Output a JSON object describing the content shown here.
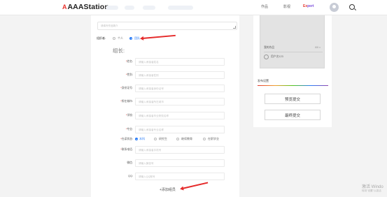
{
  "header": {
    "logo_mark": "A",
    "logo_text": "AAAStation",
    "nav_right": [
      "作品",
      "影视",
      "Expert"
    ],
    "expert_parts": [
      "Ex",
      "pert"
    ]
  },
  "form": {
    "description_placeholder": "请填写作品简介",
    "org_label": "组织者:",
    "org_options": [
      {
        "label": "个人",
        "selected": false
      },
      {
        "label": "团队",
        "selected": true
      }
    ],
    "group_title": "组长:",
    "fields": [
      {
        "label": "姓名:",
        "required": true,
        "placeholder": "请输入承接者姓名"
      },
      {
        "label": "性别:",
        "required": true,
        "placeholder": "请输入承接者性别"
      },
      {
        "label": "身份证号:",
        "required": true,
        "placeholder": "请输入承接者身份证号"
      },
      {
        "label": "所在城市:",
        "required": true,
        "placeholder": "请输入承接者所在城市"
      },
      {
        "label": "学校:",
        "required": true,
        "placeholder": "请输入承接者毕业院校名称"
      },
      {
        "label": "专业:",
        "required": true,
        "placeholder": "请输入承接者专业名称"
      }
    ],
    "status": {
      "label": "在读状态:",
      "required": true,
      "options": [
        {
          "label": "本科",
          "selected": true
        },
        {
          "label": "研究生",
          "selected": false
        },
        {
          "label": "继续教育",
          "selected": false
        },
        {
          "label": "在职学业",
          "selected": false
        }
      ]
    },
    "contact_fields": [
      {
        "label": "联系电话:",
        "required": true,
        "placeholder": "请输入承接者手机号"
      },
      {
        "label": "微信:",
        "required": false,
        "placeholder": "请输入微信号"
      },
      {
        "label": "QQ:",
        "required": false,
        "placeholder": "请输入QQ账号"
      }
    ],
    "add_group": "+添加组员"
  },
  "sidebar": {
    "thumb_title": "我的作品",
    "thumb_count": "0/0 ×",
    "user_name": "用户名123",
    "publish_label": "发布设置",
    "btn_preview": "预览提交",
    "btn_submit": "最终提交"
  },
  "watermark": {
    "line1": "激活 Windo",
    "line2": "转到\"设置\"以激活"
  },
  "colors": {
    "accent_blue": "#2b7cf6",
    "logo_red": "#e8332e",
    "annotation_red": "#e52a2a"
  }
}
